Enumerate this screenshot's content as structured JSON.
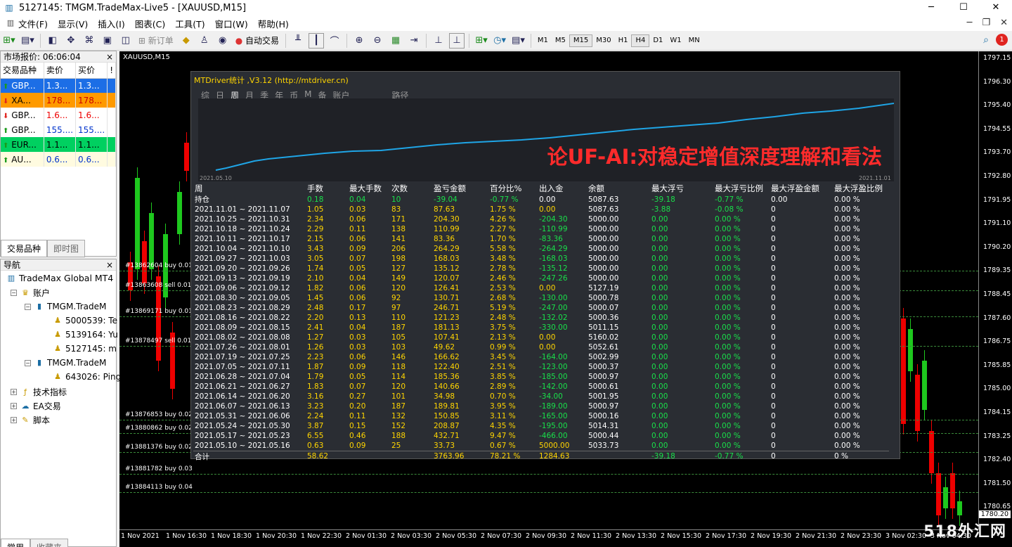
{
  "window": {
    "title": "5127145: TMGM.TradeMax-Live5 - [XAUUSD,M15]",
    "minimize": "─",
    "maximize": "☐",
    "close": "✕"
  },
  "menu": [
    "文件(F)",
    "显示(V)",
    "插入(I)",
    "图表(C)",
    "工具(T)",
    "窗口(W)",
    "帮助(H)"
  ],
  "toolbar": {
    "new_order": "新订单",
    "auto_trade": "自动交易",
    "timeframes": [
      "M1",
      "M5",
      "M15",
      "M30",
      "H1",
      "H4",
      "D1",
      "W1",
      "MN"
    ],
    "active_tf": "H4",
    "notify_count": "1"
  },
  "market_watch": {
    "title": "市场报价: 06:06:04",
    "col_symbol": "交易品种",
    "col_bid": "卖价",
    "col_ask": "买价",
    "col_more": "!",
    "rows": [
      {
        "sym": "GBP...",
        "bid": "1.3...",
        "ask": "1.3...",
        "dir": "up",
        "style": "blue"
      },
      {
        "sym": "XA...",
        "bid": "178...",
        "ask": "178...",
        "dir": "down",
        "style": "orange"
      },
      {
        "sym": "GBP...",
        "bid": "1.6...",
        "ask": "1.6...",
        "dir": "down",
        "style": "red"
      },
      {
        "sym": "GBP...",
        "bid": "155....",
        "ask": "155....",
        "dir": "up",
        "style": "bluetext"
      },
      {
        "sym": "EUR...",
        "bid": "1.1...",
        "ask": "1.1...",
        "dir": "up",
        "style": "green"
      },
      {
        "sym": "AU...",
        "bid": "0.6...",
        "ask": "0.6...",
        "dir": "up",
        "style": "yellow"
      }
    ],
    "tab_symbols": "交易品种",
    "tab_tick": "即时图"
  },
  "navigator": {
    "title": "导航",
    "root": "TradeMax Global MT4",
    "accounts": "账户",
    "server1": "TMGM.TradeM",
    "acc1": "5000539: Te",
    "acc2": "5139164: Yu",
    "acc3": "5127145: m",
    "server2": "TMGM.TradeM",
    "acc4": "643026: Ping",
    "indicators": "技术指标",
    "ea": "EA交易",
    "scripts": "脚本",
    "tab_common": "常用",
    "tab_fav": "收藏夹"
  },
  "chart": {
    "symbol_label": "XAUUSD,M15",
    "y_labels": [
      "1797.15",
      "1796.30",
      "1795.40",
      "1794.55",
      "1793.70",
      "1792.80",
      "1791.95",
      "1791.10",
      "1790.20",
      "1789.35",
      "1788.45",
      "1787.60",
      "1786.75",
      "1785.85",
      "1785.00",
      "1784.15",
      "1783.25",
      "1782.40",
      "1781.50",
      "1780.65"
    ],
    "current_price": "1780.20",
    "x_labels": [
      "1 Nov 2021",
      "1 Nov 16:30",
      "1 Nov 18:30",
      "1 Nov 20:30",
      "1 Nov 22:30",
      "2 Nov 01:30",
      "2 Nov 03:30",
      "2 Nov 05:30",
      "2 Nov 07:30",
      "2 Nov 09:30",
      "2 Nov 11:30",
      "2 Nov 13:30",
      "2 Nov 15:30",
      "2 Nov 17:30",
      "2 Nov 19:30",
      "2 Nov 21:30",
      "2 Nov 23:30",
      "3 Nov 02:30",
      "3 Nov 04:30"
    ],
    "orders": [
      "#13862604 buy 0.01",
      "#13863608 sell 0.01",
      "#13869171 buy 0.01",
      "#13878497 sell 0.01",
      "#13876853 buy 0.02",
      "#13880862 buy 0.02",
      "#13881376 buy 0.02",
      "#13881782 buy 0.03",
      "#13884113 buy 0.04"
    ]
  },
  "stats": {
    "header": "MTDriver统计 ,V3.12 (http://mtdriver.cn)",
    "tabs": [
      "综",
      "日",
      "周",
      "月",
      "季",
      "年",
      "币",
      "M",
      "备",
      "账户",
      "路径"
    ],
    "active_tab": "周",
    "curve_start": "2021.05.10",
    "curve_end": "2021.11.01",
    "watermark": "论UF-AI:对稳定增值深度理解和看法",
    "columns": [
      "周",
      "手数",
      "最大手数",
      "次数",
      "盈亏金额",
      "百分比%",
      "出入金",
      "余额",
      "最大浮亏",
      "最大浮亏比例",
      "最大浮盈金额",
      "最大浮盈比例"
    ],
    "position": {
      "label": "持仓",
      "lots": "0.18",
      "maxlots": "0.04",
      "count": "10",
      "pnl": "-39.04",
      "pct": "-0.77 %",
      "flow": "0.00",
      "balance": "5087.63",
      "maxdd": "-39.18",
      "maxddpct": "-0.77 %",
      "maxfp": "0.00",
      "maxfppct": "0.00 %"
    },
    "rows": [
      [
        "2021.11.01 ~ 2021.11.07",
        "1.05",
        "0.03",
        "83",
        "87.63",
        "1.75 %",
        "0.00",
        "5087.63",
        "-3.88",
        "-0.08 %",
        "0",
        "0.00 %"
      ],
      [
        "2021.10.25 ~ 2021.10.31",
        "2.34",
        "0.06",
        "171",
        "204.30",
        "4.26 %",
        "-204.30",
        "5000.00",
        "0.00",
        "0.00 %",
        "0",
        "0.00 %"
      ],
      [
        "2021.10.18 ~ 2021.10.24",
        "2.29",
        "0.11",
        "138",
        "110.99",
        "2.27 %",
        "-110.99",
        "5000.00",
        "0.00",
        "0.00 %",
        "0",
        "0.00 %"
      ],
      [
        "2021.10.11 ~ 2021.10.17",
        "2.15",
        "0.06",
        "141",
        "83.36",
        "1.70 %",
        "-83.36",
        "5000.00",
        "0.00",
        "0.00 %",
        "0",
        "0.00 %"
      ],
      [
        "2021.10.04 ~ 2021.10.10",
        "3.43",
        "0.09",
        "206",
        "264.29",
        "5.58 %",
        "-264.29",
        "5000.00",
        "0.00",
        "0.00 %",
        "0",
        "0.00 %"
      ],
      [
        "2021.09.27 ~ 2021.10.03",
        "3.05",
        "0.07",
        "198",
        "168.03",
        "3.48 %",
        "-168.03",
        "5000.00",
        "0.00",
        "0.00 %",
        "0",
        "0.00 %"
      ],
      [
        "2021.09.20 ~ 2021.09.26",
        "1.74",
        "0.05",
        "127",
        "135.12",
        "2.78 %",
        "-135.12",
        "5000.00",
        "0.00",
        "0.00 %",
        "0",
        "0.00 %"
      ],
      [
        "2021.09.13 ~ 2021.09.19",
        "2.10",
        "0.04",
        "149",
        "120.07",
        "2.46 %",
        "-247.26",
        "5000.00",
        "0.00",
        "0.00 %",
        "0",
        "0.00 %"
      ],
      [
        "2021.09.06 ~ 2021.09.12",
        "1.82",
        "0.06",
        "120",
        "126.41",
        "2.53 %",
        "0.00",
        "5127.19",
        "0.00",
        "0.00 %",
        "0",
        "0.00 %"
      ],
      [
        "2021.08.30 ~ 2021.09.05",
        "1.45",
        "0.06",
        "92",
        "130.71",
        "2.68 %",
        "-130.00",
        "5000.78",
        "0.00",
        "0.00 %",
        "0",
        "0.00 %"
      ],
      [
        "2021.08.23 ~ 2021.08.29",
        "2.48",
        "0.17",
        "97",
        "246.71",
        "5.19 %",
        "-247.00",
        "5000.07",
        "0.00",
        "0.00 %",
        "0",
        "0.00 %"
      ],
      [
        "2021.08.16 ~ 2021.08.22",
        "2.20",
        "0.13",
        "110",
        "121.23",
        "2.48 %",
        "-132.02",
        "5000.36",
        "0.00",
        "0.00 %",
        "0",
        "0.00 %"
      ],
      [
        "2021.08.09 ~ 2021.08.15",
        "2.41",
        "0.04",
        "187",
        "181.13",
        "3.75 %",
        "-330.00",
        "5011.15",
        "0.00",
        "0.00 %",
        "0",
        "0.00 %"
      ],
      [
        "2021.08.02 ~ 2021.08.08",
        "1.27",
        "0.03",
        "105",
        "107.41",
        "2.13 %",
        "0.00",
        "5160.02",
        "0.00",
        "0.00 %",
        "0",
        "0.00 %"
      ],
      [
        "2021.07.26 ~ 2021.08.01",
        "1.26",
        "0.03",
        "103",
        "49.62",
        "0.99 %",
        "0.00",
        "5052.61",
        "0.00",
        "0.00 %",
        "0",
        "0.00 %"
      ],
      [
        "2021.07.19 ~ 2021.07.25",
        "2.23",
        "0.06",
        "146",
        "166.62",
        "3.45 %",
        "-164.00",
        "5002.99",
        "0.00",
        "0.00 %",
        "0",
        "0.00 %"
      ],
      [
        "2021.07.05 ~ 2021.07.11",
        "1.87",
        "0.09",
        "118",
        "122.40",
        "2.51 %",
        "-123.00",
        "5000.37",
        "0.00",
        "0.00 %",
        "0",
        "0.00 %"
      ],
      [
        "2021.06.28 ~ 2021.07.04",
        "1.79",
        "0.05",
        "114",
        "185.36",
        "3.85 %",
        "-185.00",
        "5000.97",
        "0.00",
        "0.00 %",
        "0",
        "0.00 %"
      ],
      [
        "2021.06.21 ~ 2021.06.27",
        "1.83",
        "0.07",
        "120",
        "140.66",
        "2.89 %",
        "-142.00",
        "5000.61",
        "0.00",
        "0.00 %",
        "0",
        "0.00 %"
      ],
      [
        "2021.06.14 ~ 2021.06.20",
        "3.16",
        "0.27",
        "101",
        "34.98",
        "0.70 %",
        "-34.00",
        "5001.95",
        "0.00",
        "0.00 %",
        "0",
        "0.00 %"
      ],
      [
        "2021.06.07 ~ 2021.06.13",
        "3.23",
        "0.20",
        "187",
        "189.81",
        "3.95 %",
        "-189.00",
        "5000.97",
        "0.00",
        "0.00 %",
        "0",
        "0.00 %"
      ],
      [
        "2021.05.31 ~ 2021.06.06",
        "2.24",
        "0.11",
        "132",
        "150.85",
        "3.11 %",
        "-165.00",
        "5000.16",
        "0.00",
        "0.00 %",
        "0",
        "0.00 %"
      ],
      [
        "2021.05.24 ~ 2021.05.30",
        "3.87",
        "0.15",
        "152",
        "208.87",
        "4.35 %",
        "-195.00",
        "5014.31",
        "0.00",
        "0.00 %",
        "0",
        "0.00 %"
      ],
      [
        "2021.05.17 ~ 2021.05.23",
        "6.55",
        "0.46",
        "188",
        "432.71",
        "9.47 %",
        "-466.00",
        "5000.44",
        "0.00",
        "0.00 %",
        "0",
        "0.00 %"
      ],
      [
        "2021.05.10 ~ 2021.05.16",
        "0.63",
        "0.09",
        "25",
        "33.73",
        "0.67 %",
        "5000.00",
        "5033.73",
        "0.00",
        "0.00 %",
        "0",
        "0.00 %"
      ]
    ],
    "total": {
      "label": "合计",
      "lots": "58.62",
      "pnl": "3763.96",
      "pct": "78.21 %",
      "flow": "1284.63",
      "maxdd": "-39.18",
      "maxddpct": "-0.77 %",
      "maxfp": "0",
      "maxfppct": "0 %"
    }
  },
  "site_watermark": "518外汇网"
}
